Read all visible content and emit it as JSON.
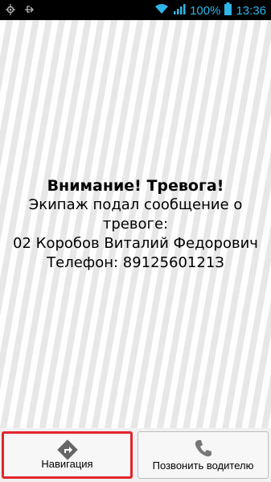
{
  "status_bar": {
    "battery_percent": "100%",
    "time": "13:36",
    "icons": [
      "gps-icon",
      "usb-icon",
      "wifi-icon",
      "signal-icon",
      "battery-icon"
    ]
  },
  "alert": {
    "title": "Внимание! Тревога!",
    "line1": "Экипаж подал сообщение о",
    "line2": "тревоге:",
    "line3": "02 Коробов Виталий Федорович",
    "line4": "Телефон: 8912560121З"
  },
  "buttons": {
    "navigation": "Навигация",
    "call_driver": "Позвонить водителю"
  },
  "colors": {
    "accent": "#2fb5e8",
    "highlight": "#e0262b"
  }
}
